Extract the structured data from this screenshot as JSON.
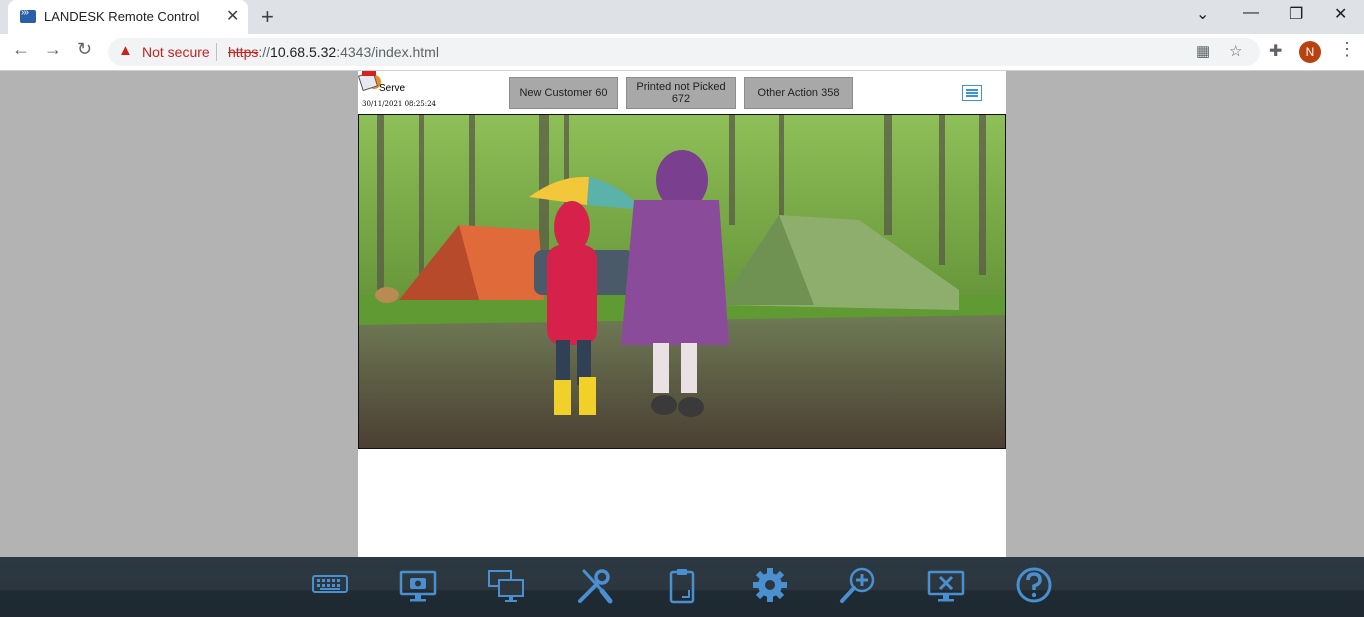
{
  "browser": {
    "tab_title": "LANDESK Remote Control",
    "security_label": "Not secure",
    "url_scheme": "https",
    "url_sep": "://",
    "url_host": "10.68.5.32",
    "url_path": ":4343/index.html",
    "profile_initial": "N"
  },
  "page": {
    "app_label": "Serve",
    "timestamp": "30/11/2021 08:25:24",
    "buttons": [
      {
        "label": "New Customer 60"
      },
      {
        "label": "Printed not Picked\n672"
      },
      {
        "label": "Other Action 358"
      }
    ],
    "photo_description": "Two children in rain coats walking on a forest path at a campsite"
  },
  "remote_toolbar": {
    "icons": [
      "keyboard-icon",
      "screenshot-icon",
      "multi-monitor-icon",
      "tools-icon",
      "clipboard-icon",
      "settings-gear-icon",
      "zoom-in-icon",
      "disconnect-icon",
      "help-icon"
    ]
  },
  "colors": {
    "accent": "#3a95d8",
    "toolbar_icon": "#4a8fd0",
    "button_gray": "#a8a8a8",
    "warning_red": "#c5221f"
  }
}
